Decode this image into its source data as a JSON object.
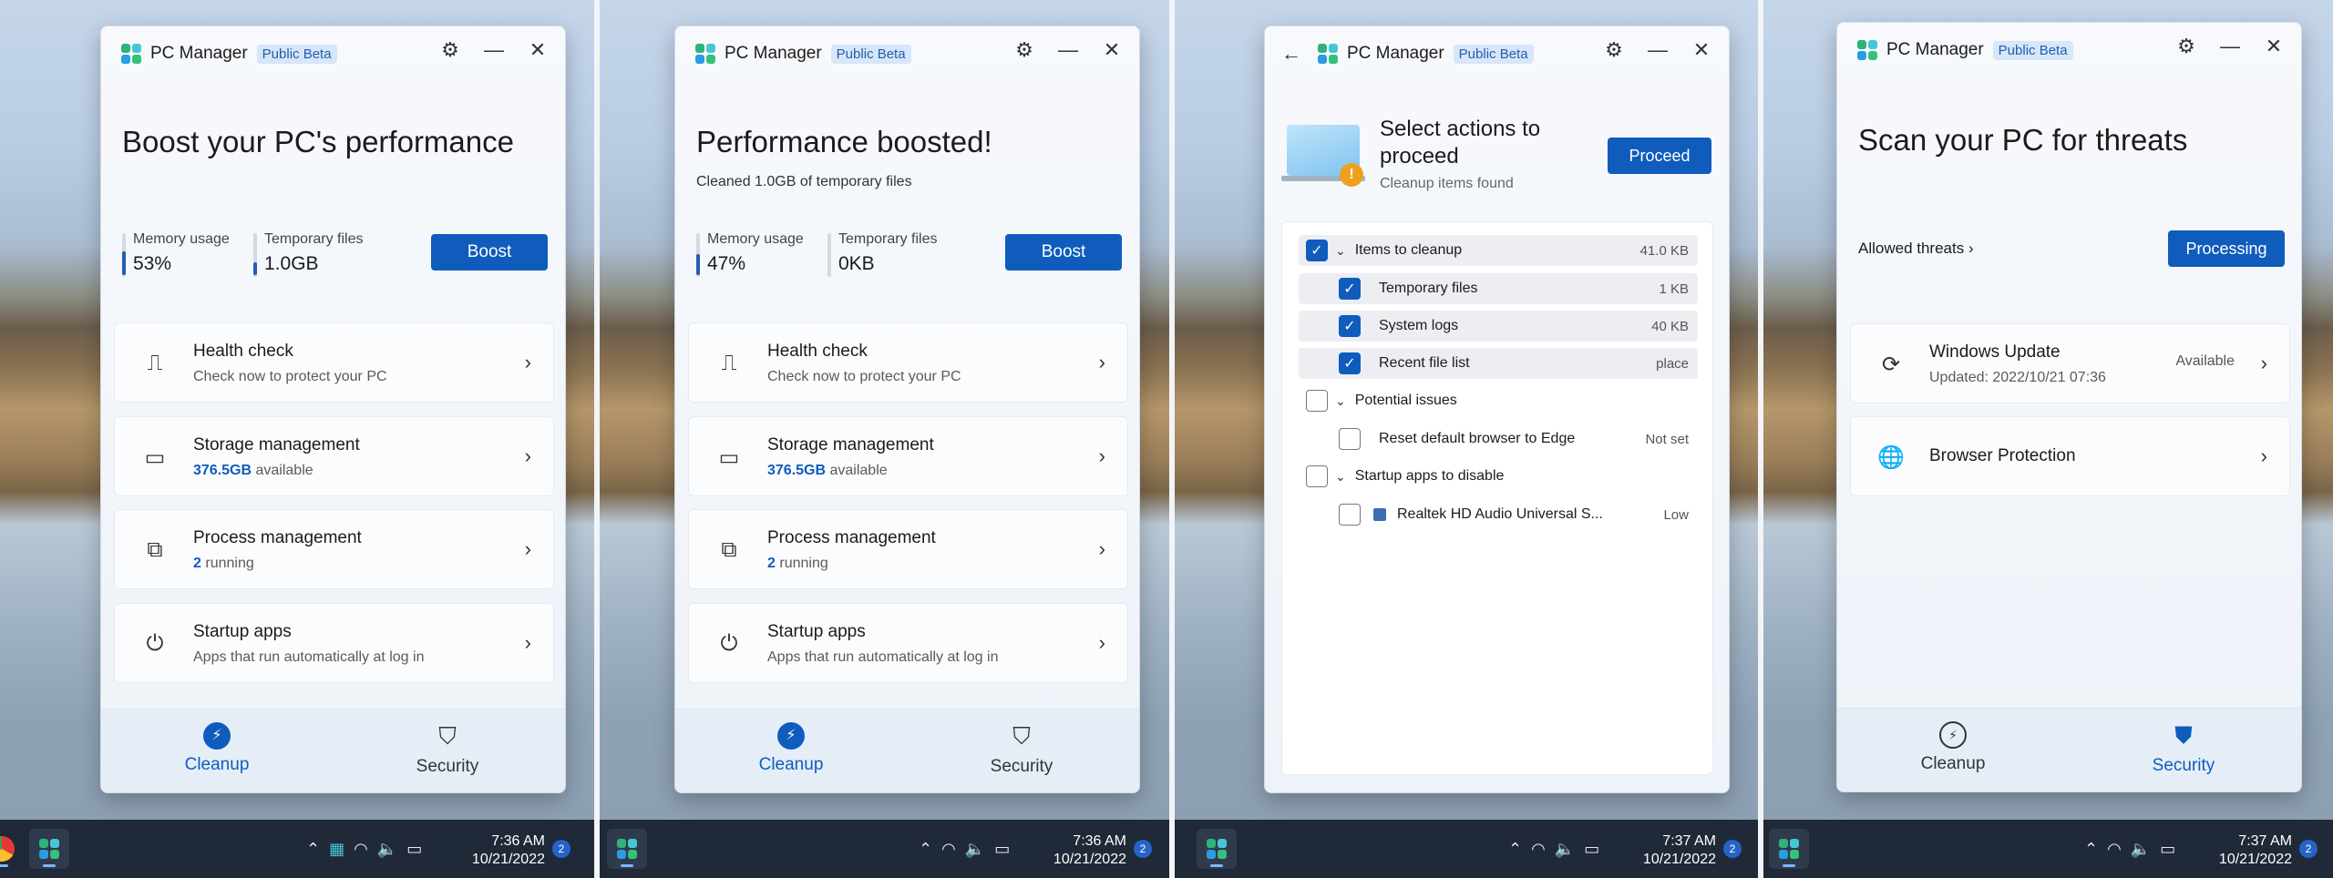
{
  "app": {
    "name": "PC Manager",
    "badge": "Public Beta"
  },
  "colors": {
    "accent": "#0f5cbd",
    "taskbar": "#1f2937"
  },
  "win1": {
    "headline": "Boost your PC's performance",
    "memory": {
      "label": "Memory usage",
      "value": "53%",
      "level": 0.53
    },
    "temp": {
      "label": "Temporary files",
      "value": "1.0GB",
      "level": 0.3
    },
    "boost": "Boost",
    "cards": [
      {
        "title": "Health check",
        "sub": "Check now to protect your PC",
        "icon": "pulse-monitor-icon"
      },
      {
        "title": "Storage management",
        "sub_strong": "376.5GB",
        "sub": "available",
        "icon": "drive-icon"
      },
      {
        "title": "Process management",
        "sub_strong": "2",
        "sub": "running",
        "icon": "process-icon"
      },
      {
        "title": "Startup apps",
        "sub": "Apps that run automatically at log in",
        "icon": "power-icon"
      }
    ],
    "nav": {
      "cleanup": "Cleanup",
      "security": "Security"
    }
  },
  "win2": {
    "headline": "Performance boosted!",
    "subline": "Cleaned 1.0GB of temporary files",
    "memory": {
      "label": "Memory usage",
      "value": "47%",
      "level": 0.47
    },
    "temp": {
      "label": "Temporary files",
      "value": "0KB",
      "level": 0
    },
    "boost": "Boost"
  },
  "win3": {
    "headline_1": "Select actions to",
    "headline_2": "proceed",
    "subline": "Cleanup items found",
    "proceed": "Proceed",
    "items": [
      {
        "label": "Items to cleanup",
        "value": "41.0 KB"
      },
      {
        "label": "Temporary files",
        "value": "1 KB"
      },
      {
        "label": "System logs",
        "value": "40 KB"
      },
      {
        "label": "Recent file list",
        "value": "place"
      },
      {
        "label": "Potential issues",
        "value": ""
      },
      {
        "label": "Reset default browser to Edge",
        "value": "Not set"
      },
      {
        "label": "Startup apps to disable",
        "value": ""
      },
      {
        "label": "Realtek HD Audio Universal S...",
        "value": "Low"
      }
    ]
  },
  "win4": {
    "headline": "Scan your PC for threats",
    "allowed": "Allowed threats",
    "processing": "Processing",
    "update": {
      "title": "Windows Update",
      "sub": "Updated: 2022/10/21 07:36",
      "status": "Available"
    },
    "browser": {
      "title": "Browser Protection"
    }
  },
  "taskbar": [
    {
      "time": "7:36 AM",
      "date": "10/21/2022",
      "badge": "2"
    },
    {
      "time": "7:36 AM",
      "date": "10/21/2022",
      "badge": "2"
    },
    {
      "time": "7:37 AM",
      "date": "10/21/2022",
      "badge": "2"
    },
    {
      "time": "7:37 AM",
      "date": "10/21/2022",
      "badge": "2"
    }
  ]
}
